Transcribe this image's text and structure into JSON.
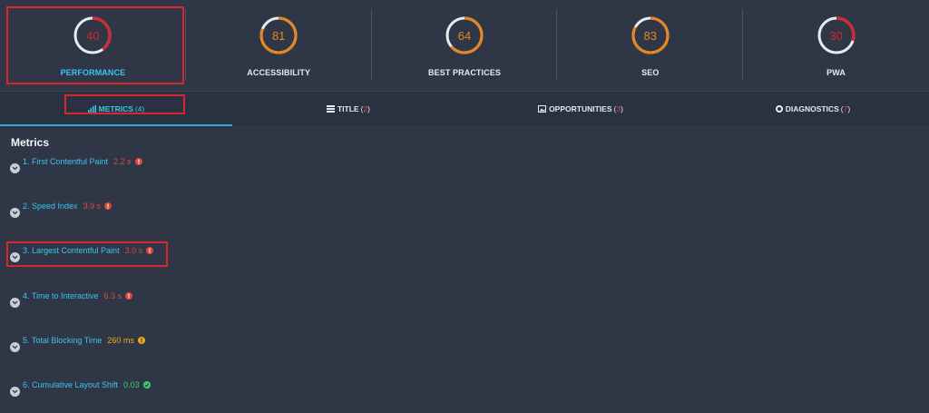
{
  "scores": [
    {
      "label": "PERFORMANCE",
      "value": 40,
      "color": "#d9252b",
      "active": true
    },
    {
      "label": "ACCESSIBILITY",
      "value": 81,
      "color": "#e8861e",
      "active": false
    },
    {
      "label": "BEST PRACTICES",
      "value": 64,
      "color": "#e8861e",
      "active": false
    },
    {
      "label": "SEO",
      "value": 83,
      "color": "#e8861e",
      "active": false
    },
    {
      "label": "PWA",
      "value": 30,
      "color": "#d9252b",
      "active": false
    }
  ],
  "tabs": [
    {
      "label": "METRICS",
      "count": "4",
      "icon": "bar-chart-icon",
      "active": true
    },
    {
      "label": "TITLE",
      "count": "2",
      "icon": "stack-icon",
      "active": false
    },
    {
      "label": "OPPORTUNITIES",
      "count": "3",
      "icon": "image-icon",
      "active": false
    },
    {
      "label": "DIAGNOSTICS",
      "count": "7",
      "icon": "gear-icon",
      "active": false
    }
  ],
  "metrics_title": "Metrics",
  "metrics": [
    {
      "label": "1. First Contentful Paint",
      "value": "2.2 s",
      "status": "fail",
      "status_icon": "alert-icon"
    },
    {
      "label": "2. Speed Index",
      "value": "3.9 s",
      "status": "fail",
      "status_icon": "alert-icon"
    },
    {
      "label": "3. Largest Contentful Paint",
      "value": "3.0 s",
      "status": "fail",
      "status_icon": "alert-icon"
    },
    {
      "label": "4. Time to Interactive",
      "value": "6.3 s",
      "status": "fail",
      "status_icon": "alert-icon"
    },
    {
      "label": "5. Total Blocking Time",
      "value": "260 ms",
      "status": "average",
      "status_icon": "alert-icon"
    },
    {
      "label": "6. Cumulative Layout Shift",
      "value": "0.03",
      "status": "pass",
      "status_icon": "check-icon"
    }
  ],
  "colors": {
    "fail": "#e0473c",
    "average": "#f0a81e",
    "pass": "#3fcf6a",
    "accent": "#3ec3f0",
    "highlight": "#d9252b"
  }
}
